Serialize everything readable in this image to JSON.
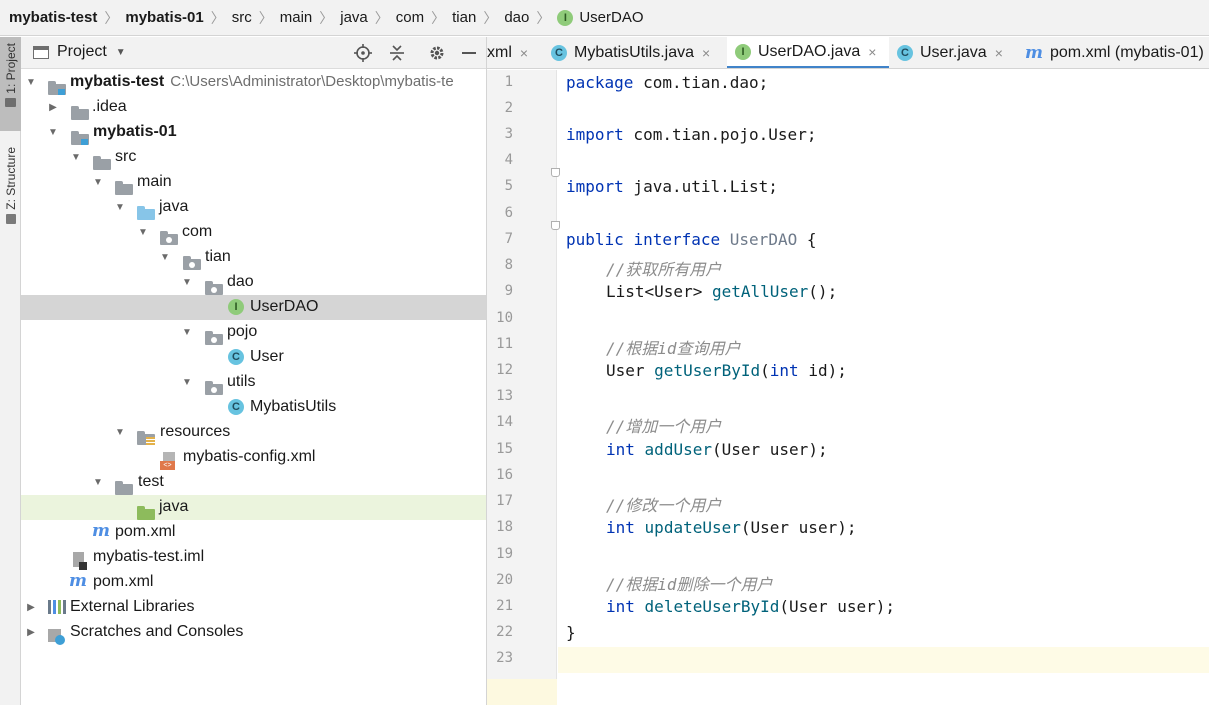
{
  "breadcrumb": [
    "mybatis-test",
    "mybatis-01",
    "src",
    "main",
    "java",
    "com",
    "tian",
    "dao",
    "UserDAO"
  ],
  "tool_strip": {
    "project": "1: Project",
    "structure": "Z: Structure"
  },
  "panel": {
    "title": "Project"
  },
  "tree": {
    "root_label": "mybatis-test",
    "root_path": "C:\\Users\\Administrator\\Desktop\\mybatis-te",
    "idea": ".idea",
    "module": "mybatis-01",
    "src": "src",
    "main": "main",
    "java": "java",
    "com": "com",
    "tian": "tian",
    "dao": "dao",
    "userdao": "UserDAO",
    "pojo": "pojo",
    "user": "User",
    "utils": "utils",
    "mybatisutils": "MybatisUtils",
    "resources": "resources",
    "config": "mybatis-config.xml",
    "test": "test",
    "test_java": "java",
    "module_pom": "pom.xml",
    "iml": "mybatis-test.iml",
    "root_pom": "pom.xml",
    "ext_libs": "External Libraries",
    "scratches": "Scratches and Consoles"
  },
  "tabs": [
    {
      "label": "xml",
      "icon": "none"
    },
    {
      "label": "MybatisUtils.java",
      "icon": "C"
    },
    {
      "label": "UserDAO.java",
      "icon": "I",
      "active": true
    },
    {
      "label": "User.java",
      "icon": "C"
    },
    {
      "label": "pom.xml (mybatis-01)",
      "icon": "m"
    }
  ],
  "icons": {
    "interface_letter": "I",
    "class_letter": "C",
    "close_glyph": "×",
    "maven_letter": "m"
  },
  "line_numbers": [
    "1",
    "2",
    "3",
    "4",
    "5",
    "6",
    "7",
    "8",
    "9",
    "10",
    "11",
    "12",
    "13",
    "14",
    "15",
    "16",
    "17",
    "18",
    "19",
    "20",
    "21",
    "22",
    "23"
  ],
  "code": {
    "l1_kw": "package",
    "l1_rest": " com.tian.dao;",
    "l3_kw": "import",
    "l3_rest": " com.tian.pojo.User;",
    "l5_kw": "import",
    "l5_rest": " java.util.List;",
    "l7_kw1": "public",
    "l7_kw2": "interface",
    "l7_name": "UserDAO",
    "l7_brace": " {",
    "l8_cm": "//获取所有用户",
    "l9_type": "List<User>",
    "l9_fn": "getAllUser",
    "l9_rest": "();",
    "l11_cm": "//根据id查询用户",
    "l12_type": "User",
    "l12_fn": "getUserById",
    "l12_open": "(",
    "l12_kw": "int",
    "l12_rest": " id);",
    "l14_cm": "//增加一个用户",
    "l15_kw": "int",
    "l15_fn": "addUser",
    "l15_rest": "(User user);",
    "l17_cm": "//修改一个用户",
    "l18_kw": "int",
    "l18_fn": "updateUser",
    "l18_rest": "(User user);",
    "l20_cm": "//根据id删除一个用户",
    "l21_kw": "int",
    "l21_fn": "deleteUserById",
    "l21_rest": "(User user);",
    "l22": "}"
  },
  "colors": {
    "keyword": "#0033b3",
    "method": "#00627a",
    "comment": "#8c8c8c",
    "accent": "#4083c9"
  }
}
